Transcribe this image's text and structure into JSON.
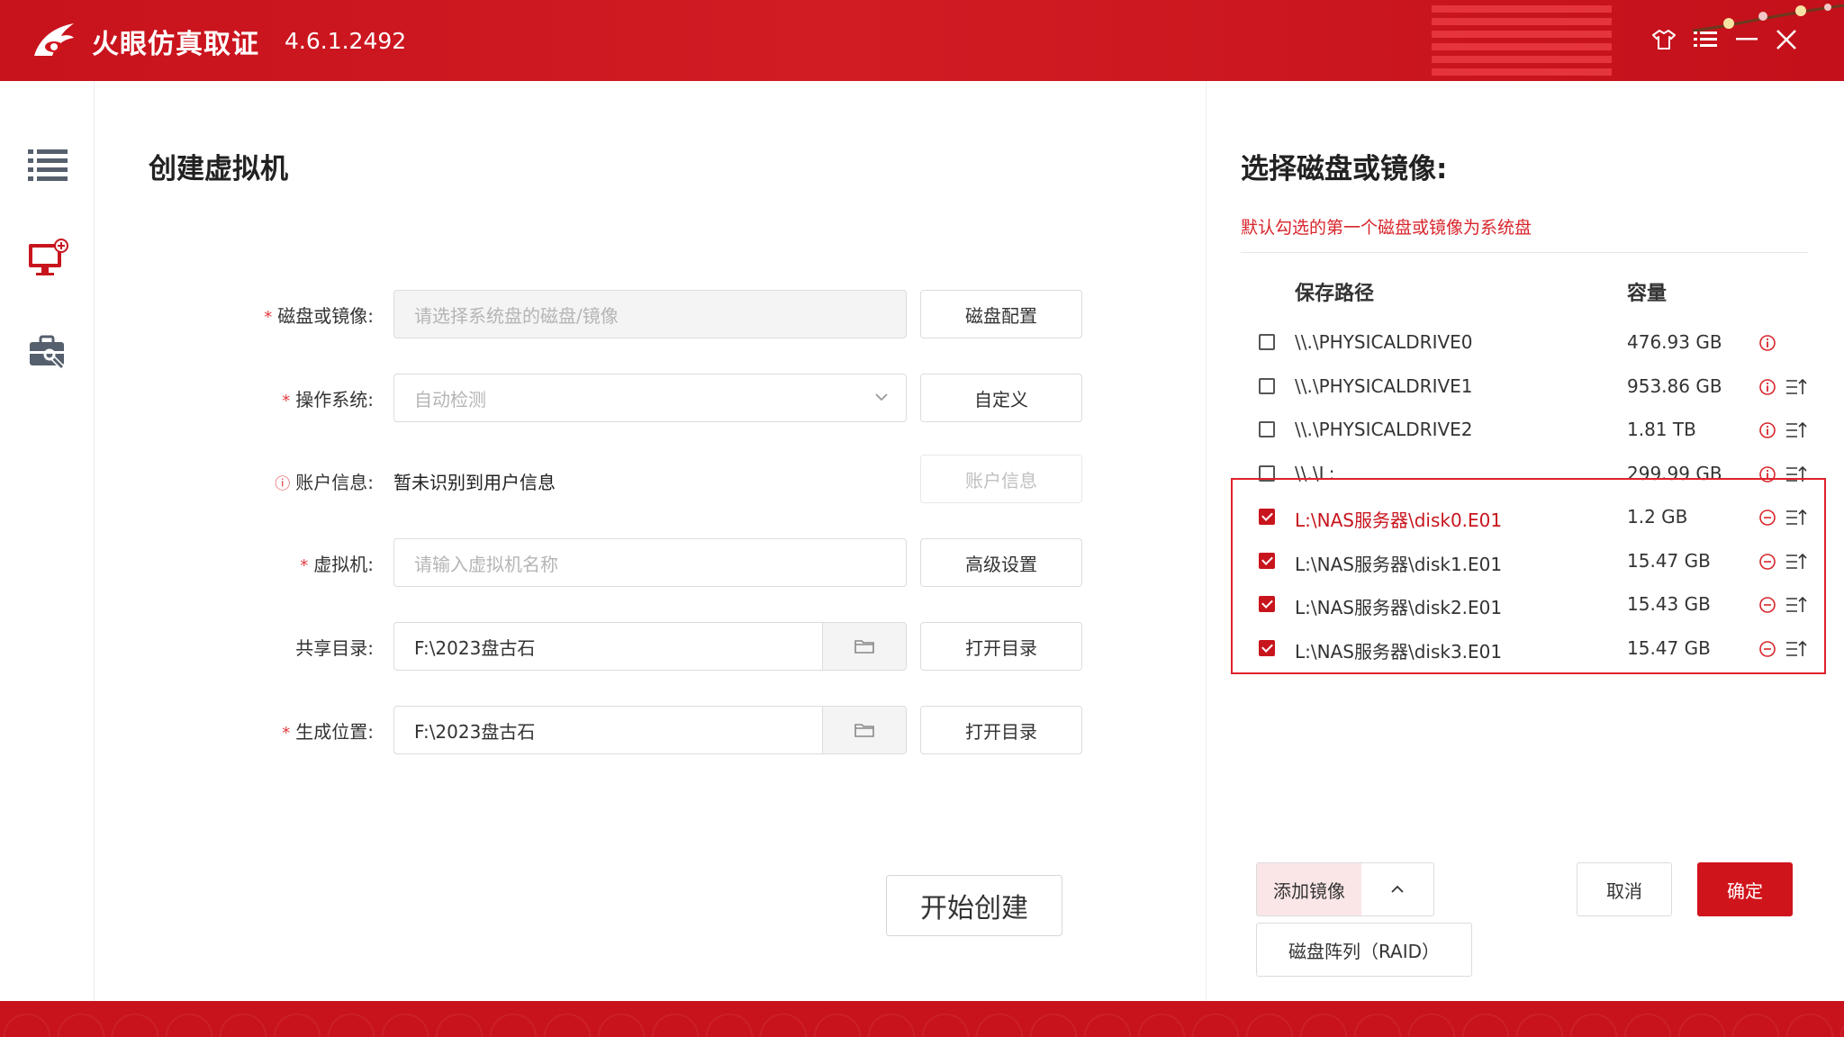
{
  "app": {
    "title": "火眼仿真取证",
    "version": "4.6.1.2492",
    "accent_color": "#d0141c",
    "titlebar_icons": [
      "skin-icon",
      "menu-icon",
      "minimize-icon",
      "close-icon"
    ]
  },
  "sidebar": {
    "items": [
      {
        "icon": "list-icon"
      },
      {
        "icon": "monitor-add-icon"
      },
      {
        "icon": "toolbox-icon"
      }
    ]
  },
  "create": {
    "title": "创建虚拟机",
    "disk": {
      "label": "磁盘或镜像:",
      "placeholder": "请选择系统盘的磁盘/镜像",
      "button": "磁盘配置"
    },
    "os": {
      "label": "操作系统:",
      "value": "自动检测",
      "button": "自定义"
    },
    "account": {
      "label": "账户信息:",
      "value": "暂未识别到用户信息",
      "button": "账户信息"
    },
    "vm": {
      "label": "虚拟机:",
      "placeholder": "请输入虚拟机名称",
      "button": "高级设置"
    },
    "share": {
      "label": "共享目录:",
      "value": "F:\\2023盘古石",
      "button": "打开目录"
    },
    "output": {
      "label": "生成位置:",
      "value": "F:\\2023盘古石",
      "button": "打开目录"
    },
    "start_button": "开始创建"
  },
  "disks": {
    "title": "选择磁盘或镜像:",
    "hint": "默认勾选的第一个磁盘或镜像为系统盘",
    "columns": {
      "path": "保存路径",
      "size": "容量"
    },
    "rows": [
      {
        "path": "\\\\.\\PHYSICALDRIVE0",
        "size": "476.93 GB",
        "checked": false
      },
      {
        "path": "\\\\.\\PHYSICALDRIVE1",
        "size": "953.86 GB",
        "checked": false
      },
      {
        "path": "\\\\.\\PHYSICALDRIVE2",
        "size": "1.81 TB",
        "checked": false
      },
      {
        "path": "\\\\.\\L:",
        "size": "299.99 GB",
        "checked": false
      },
      {
        "path": "L:\\NAS服务器\\disk0.E01",
        "size": "1.2 GB",
        "checked": true
      },
      {
        "path": "L:\\NAS服务器\\disk1.E01",
        "size": "15.47 GB",
        "checked": true
      },
      {
        "path": "L:\\NAS服务器\\disk2.E01",
        "size": "15.43 GB",
        "checked": true
      },
      {
        "path": "L:\\NAS服务器\\disk3.E01",
        "size": "15.47 GB",
        "checked": true
      }
    ],
    "add_image": "添加镜像",
    "raid": "磁盘阵列（RAID）",
    "cancel": "取消",
    "confirm": "确定"
  }
}
